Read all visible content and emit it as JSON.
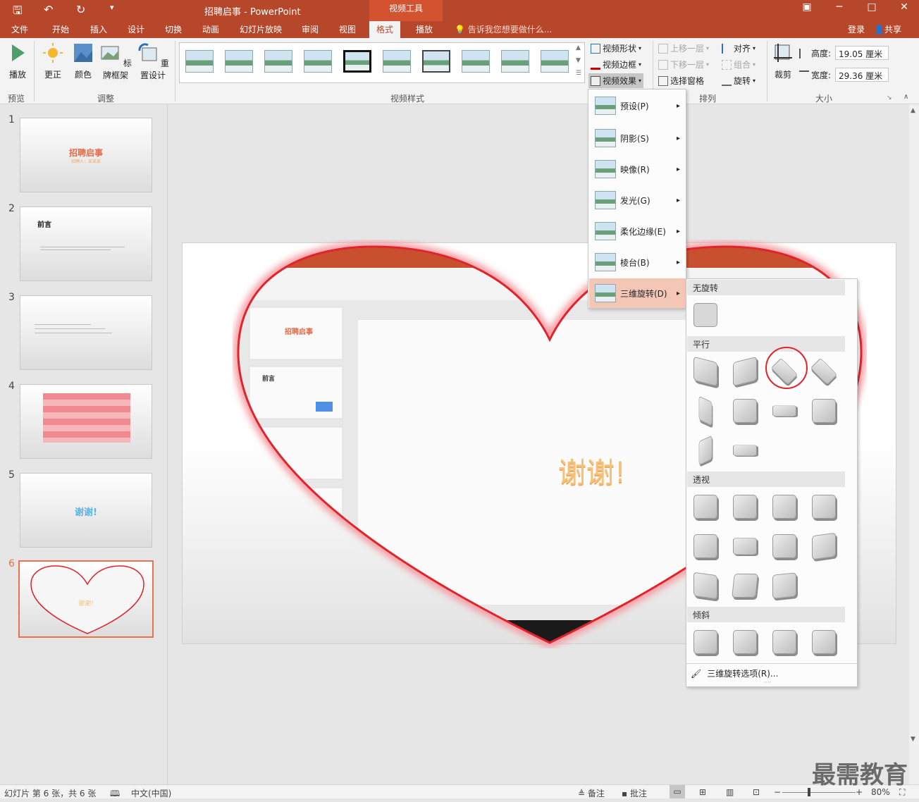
{
  "window": {
    "title": "招聘启事 - PowerPoint",
    "context_tool": "视频工具",
    "controls": [
      "▣",
      "─",
      "□",
      "✕"
    ]
  },
  "tabs": [
    "文件",
    "开始",
    "插入",
    "设计",
    "切换",
    "动画",
    "幻灯片放映",
    "审阅",
    "视图",
    "格式",
    "播放"
  ],
  "active_tab": "格式",
  "tell_me": "告诉我您想要做什么...",
  "signin": "登录",
  "share": "共享",
  "ribbon": {
    "preview": {
      "play": "播放",
      "group": "预览"
    },
    "adjust": {
      "correct": "更正",
      "color": "颜色",
      "poster": "标牌框架",
      "reset": "重置设计",
      "group": "调整"
    },
    "styles_group": "视频样式",
    "video_shape": "视频形状",
    "video_border": "视频边框",
    "video_effects": "视频效果",
    "arrange": {
      "bring_forward": "上移一层",
      "send_backward": "下移一层",
      "selection_pane": "选择窗格",
      "align": "对齐",
      "group": "组合",
      "rotate": "旋转",
      "group_label": "排列"
    },
    "size": {
      "crop": "裁剪",
      "height_label": "高度:",
      "height_value": "19.05 厘米",
      "width_label": "宽度:",
      "width_value": "29.36 厘米",
      "group_label": "大小"
    }
  },
  "slides": [
    {
      "num": "1",
      "title": "招聘启事",
      "sub": "招聘人：某某某"
    },
    {
      "num": "2",
      "title": "前言"
    },
    {
      "num": "3"
    },
    {
      "num": "4"
    },
    {
      "num": "5",
      "title": "谢谢!"
    },
    {
      "num": "6",
      "title": "谢谢!"
    }
  ],
  "main_slide": {
    "text": "谢谢!",
    "embedded_slide1": "招聘启事",
    "embedded_slide2": "前言"
  },
  "effects_menu": [
    {
      "label": "预设(P)"
    },
    {
      "label": "阴影(S)"
    },
    {
      "label": "映像(R)"
    },
    {
      "label": "发光(G)"
    },
    {
      "label": "柔化边缘(E)"
    },
    {
      "label": "棱台(B)"
    },
    {
      "label": "三维旋转(D)"
    }
  ],
  "gallery": {
    "sections": [
      "无旋转",
      "平行",
      "透视",
      "倾斜"
    ],
    "options_label": "三维旋转选项(R)..."
  },
  "status": {
    "slide_info": "幻灯片 第 6 张，共 6 张",
    "language": "中文(中国)",
    "notes": "备注",
    "comments": "批注",
    "zoom": "80%"
  },
  "watermark": "最需教育",
  "colors": {
    "accent": "#b7472a",
    "highlight": "#f4c6b5",
    "heart": "#e0242c"
  }
}
